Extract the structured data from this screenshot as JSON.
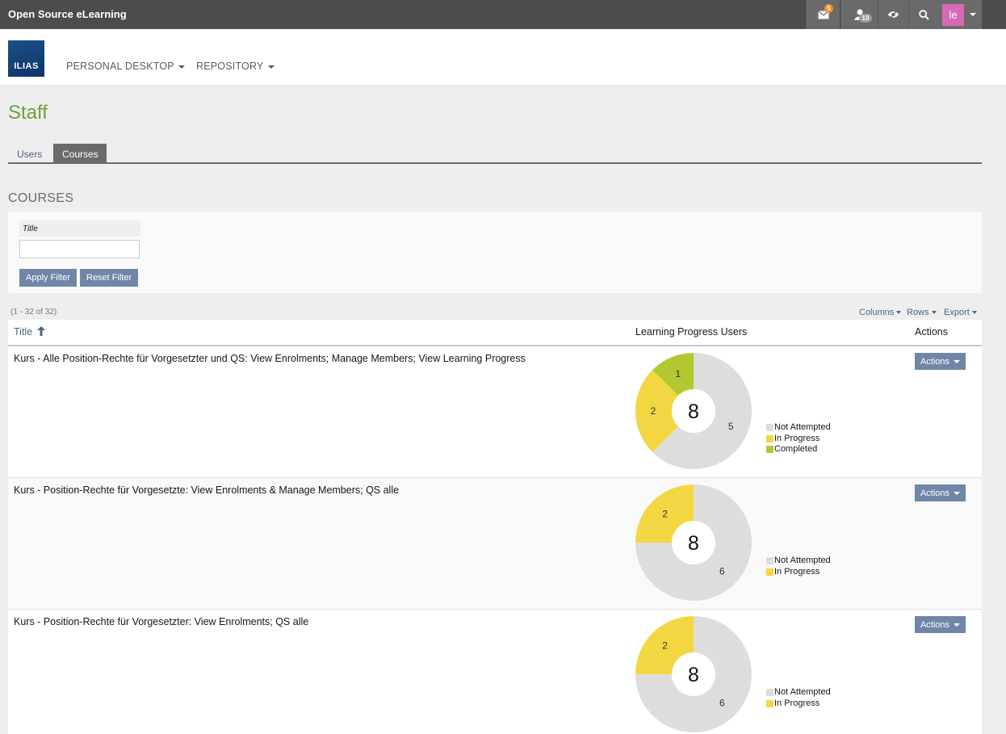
{
  "topbar": {
    "site_title": "Open Source eLearning",
    "mail_badge": "5",
    "contacts_badge": "10",
    "avatar_initials": "le"
  },
  "header": {
    "logo_text": "ILIAS",
    "nav": [
      {
        "label": "PERSONAL DESKTOP"
      },
      {
        "label": "REPOSITORY"
      }
    ]
  },
  "page": {
    "title": "Staff",
    "tabs": [
      {
        "label": "Users",
        "active": false
      },
      {
        "label": "Courses",
        "active": true
      }
    ],
    "section_title": "COURSES"
  },
  "filter": {
    "title_label": "Title",
    "title_value": "",
    "apply_label": "Apply Filter",
    "reset_label": "Reset Filter"
  },
  "table": {
    "count": "(1 - 32 of 32)",
    "controls": {
      "columns": "Columns",
      "rows": "Rows",
      "export": "Export"
    },
    "headers": {
      "title": "Title",
      "progress": "Learning Progress Users",
      "actions": "Actions"
    },
    "action_label": "Actions",
    "rows": [
      {
        "title": "Kurs - Alle Position-Rechte für Vorgesetzter und QS: View Enrolments; Manage Members; View Learning Progress",
        "total": "8",
        "segments": [
          {
            "label": "Not Attempted",
            "value": 5,
            "color": "#dddddd"
          },
          {
            "label": "In Progress",
            "value": 2,
            "color": "#f3d742"
          },
          {
            "label": "Completed",
            "value": 1,
            "color": "#b3c830"
          }
        ]
      },
      {
        "title": "Kurs - Position-Rechte für Vorgesetzte: View Enrolments & Manage Members; QS alle",
        "total": "8",
        "segments": [
          {
            "label": "Not Attempted",
            "value": 6,
            "color": "#dddddd"
          },
          {
            "label": "In Progress",
            "value": 2,
            "color": "#f3d742"
          }
        ]
      },
      {
        "title": "Kurs - Position-Rechte für Vorgesetzter: View Enrolments; QS alle",
        "total": "8",
        "segments": [
          {
            "label": "Not Attempted",
            "value": 6,
            "color": "#dddddd"
          },
          {
            "label": "In Progress",
            "value": 2,
            "color": "#f3d742"
          }
        ]
      }
    ]
  },
  "icons": [
    "mail-icon",
    "user-icon",
    "eye-icon",
    "search-icon",
    "sort-up-icon",
    "caret-down-icon"
  ]
}
